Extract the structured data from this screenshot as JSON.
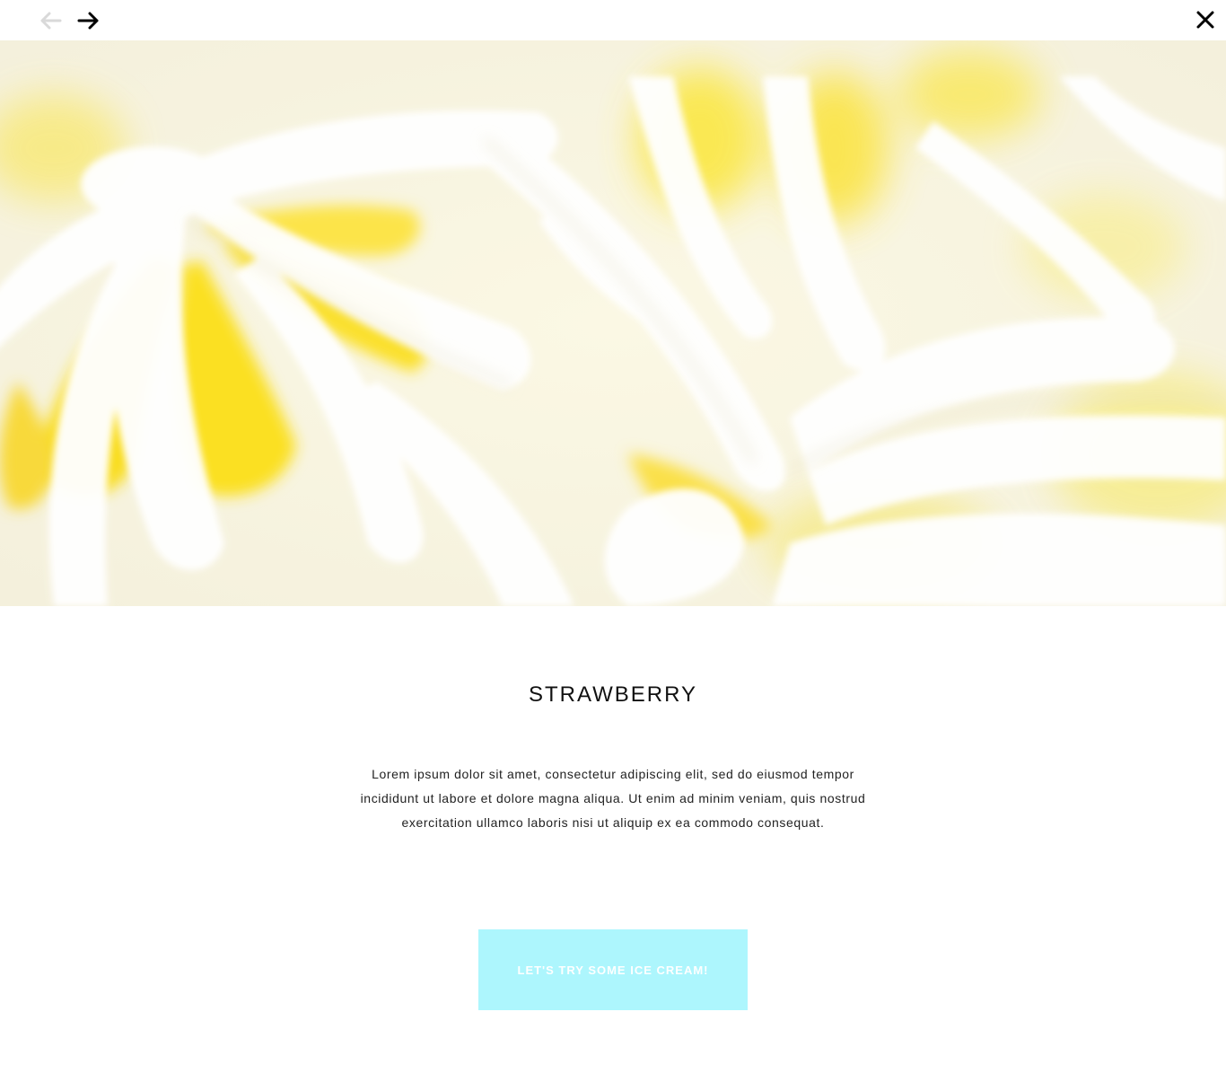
{
  "nav": {
    "prev_icon": "arrow-left-icon",
    "next_icon": "arrow-right-icon",
    "close_icon": "close-icon",
    "prev_color": "#d9d9d9",
    "next_color": "#000000"
  },
  "hero": {
    "image": "lemon-ice-cream-swirls",
    "colors": [
      "#f8f6eb",
      "#fbe94a",
      "#ffffff"
    ]
  },
  "product": {
    "title": "STRAWBERRY",
    "description": "Lorem ipsum dolor sit amet, consectetur adipiscing elit, sed do eiusmod tempor incididunt ut labore et dolore magna aliqua. Ut enim ad minim veniam, quis nostrud exercitation ullamco laboris nisi ut aliquip ex ea commodo consequat."
  },
  "cta": {
    "label": "LET'S TRY SOME ICE CREAM!",
    "color": "#adf6fd"
  }
}
